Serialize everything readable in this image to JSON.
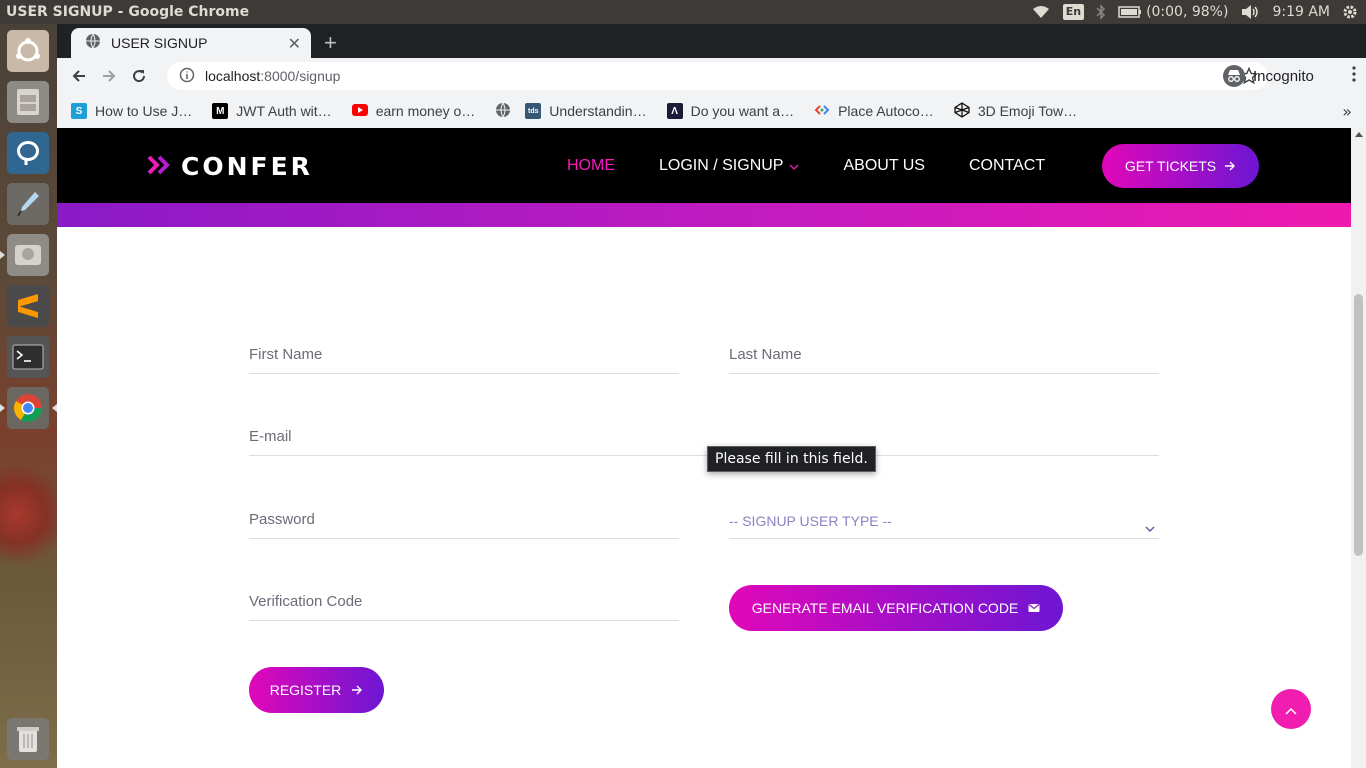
{
  "os": {
    "window_title": "USER SIGNUP - Google Chrome",
    "keyboard_lang": "En",
    "battery": "(0:00, 98%)",
    "clock": "9:19 AM"
  },
  "browser": {
    "tab_title": "USER SIGNUP",
    "url_host": "localhost",
    "url_path": ":8000/signup",
    "profile_label": "Incognito",
    "bookmarks": [
      {
        "label": "How to Use J…",
        "icon": "stackshare-favicon",
        "color": "#1ea0d7"
      },
      {
        "label": "JWT Auth wit…",
        "icon": "medium-favicon",
        "color": "#000000"
      },
      {
        "label": "earn money o…",
        "icon": "youtube-favicon",
        "color": "#ff0000"
      },
      {
        "label": "",
        "icon": "globe-favicon",
        "color": "#5f6368"
      },
      {
        "label": "Understandin…",
        "icon": "tds-favicon",
        "color": "#355876"
      },
      {
        "label": "Do you want a…",
        "icon": "aw-favicon",
        "color": "#1b1b3a"
      },
      {
        "label": "Place Autoco…",
        "icon": "google-dev-favicon",
        "color": "#4285f4"
      },
      {
        "label": "3D Emoji Tow…",
        "icon": "codepen-favicon",
        "color": "#111111"
      }
    ]
  },
  "site": {
    "logo_text": "CONFER",
    "nav": {
      "home": "HOME",
      "login_signup": "LOGIN / SIGNUP",
      "about": "ABOUT US",
      "contact": "CONTACT"
    },
    "tickets_label": "GET TICKETS",
    "accent_color": "#f81bbf"
  },
  "form": {
    "first_name_placeholder": "First Name",
    "last_name_placeholder": "Last Name",
    "email_placeholder": "E-mail",
    "password_placeholder": "Password",
    "user_type_selected": "-- SIGNUP USER TYPE --",
    "verification_placeholder": "Verification Code",
    "generate_label": "GENERATE EMAIL VERIFICATION CODE",
    "register_label": "REGISTER",
    "validation_tooltip": "Please fill in this field."
  }
}
